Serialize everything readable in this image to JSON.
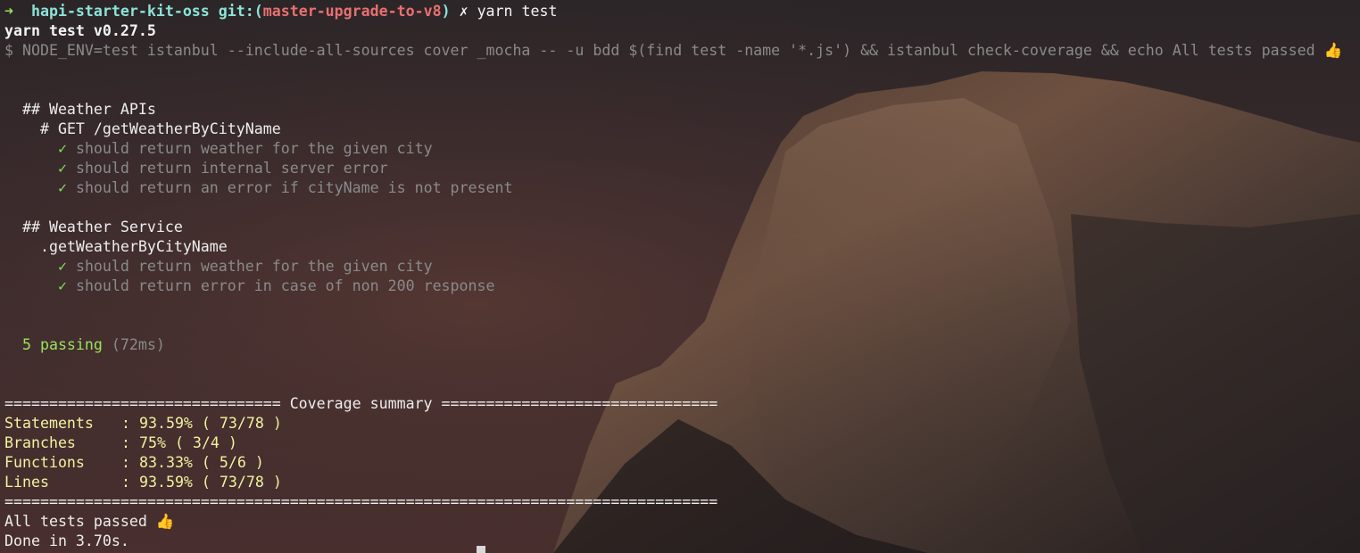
{
  "prompt": {
    "arrow": "➜",
    "directory": "hapi-starter-kit-oss",
    "git_prefix": "git:(",
    "branch": "master-upgrade-to-v8",
    "git_suffix": ")",
    "dirty_mark": "✗",
    "command": "yarn test"
  },
  "yarn_version": "yarn test v0.27.5",
  "run_command": "$ NODE_ENV=test istanbul --include-all-sources cover _mocha -- -u bdd $(find test -name '*.js') && istanbul check-coverage && echo All tests passed 👍",
  "suites": [
    {
      "title": "## Weather APIs",
      "subtitle": "# GET /getWeatherByCityName",
      "tests": [
        "should return weather for the given city",
        "should return internal server error",
        "should return an error if cityName is not present"
      ]
    },
    {
      "title": "## Weather Service",
      "subtitle": ".getWeatherByCityName",
      "tests": [
        "should return weather for the given city",
        "should return error in case of non 200 response"
      ]
    }
  ],
  "check_mark": "✓",
  "result": {
    "passing": "5 passing",
    "duration": "(72ms)"
  },
  "coverage": {
    "header": "=============================== Coverage summary ===============================",
    "rows": [
      {
        "label": "Statements",
        "value": "93.59% ( 73/78 )"
      },
      {
        "label": "Branches",
        "value": "75% ( 3/4 )"
      },
      {
        "label": "Functions",
        "value": "83.33% ( 5/6 )"
      },
      {
        "label": "Lines",
        "value": "93.59% ( 73/78 )"
      }
    ],
    "separator": ": ",
    "footer": "================================================================================"
  },
  "echo_output": "All tests passed 👍",
  "done": "Done in 3.70s."
}
